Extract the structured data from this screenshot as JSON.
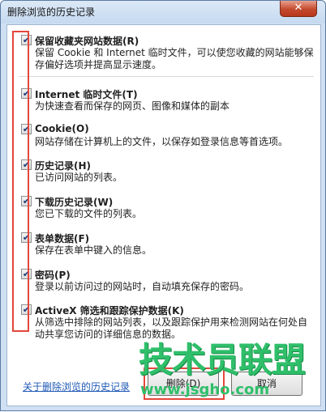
{
  "window": {
    "title": "删除浏览的历史记录",
    "close_label": "✕"
  },
  "options": [
    {
      "label": "保留收藏夹网站数据(R)",
      "checked": true,
      "desc": "保留 Cookie 和 Internet 临时文件，可以使您收藏的网站能够保存偏好选项并提高显示速度。"
    },
    {
      "label": "Internet 临时文件(T)",
      "checked": true,
      "desc": "为快速查看而保存的网页、图像和媒体的副本"
    },
    {
      "label": "Cookie(O)",
      "checked": true,
      "desc": "网站存储在计算机上的文件，以保存如登录信息等首选项。"
    },
    {
      "label": "历史记录(H)",
      "checked": true,
      "desc": "已访问网站的列表。"
    },
    {
      "label": "下载历史记录(W)",
      "checked": true,
      "desc": "您已下载的文件的列表。"
    },
    {
      "label": "表单数据(F)",
      "checked": true,
      "desc": "保存在表单中键入的信息。"
    },
    {
      "label": "密码(P)",
      "checked": true,
      "desc": "登录以前访问过的网站时，自动填充保存的密码。"
    },
    {
      "label": "ActiveX 筛选和跟踪保护数据(K)",
      "checked": true,
      "desc": "从筛选中排除的网站列表，以及跟踪保护用来检测网站在何处自动共享您访问的详细信息的数据。"
    }
  ],
  "footer": {
    "link": "关于删除浏览的历史记录",
    "delete_label": "删除(D)",
    "cancel_label": "取消"
  },
  "watermark": {
    "text": "技术员联盟",
    "url": "www.jsgho.com"
  },
  "colors": {
    "highlight": "#e4473b",
    "watermark": "#2fbf6a",
    "link": "#1f59b5"
  }
}
